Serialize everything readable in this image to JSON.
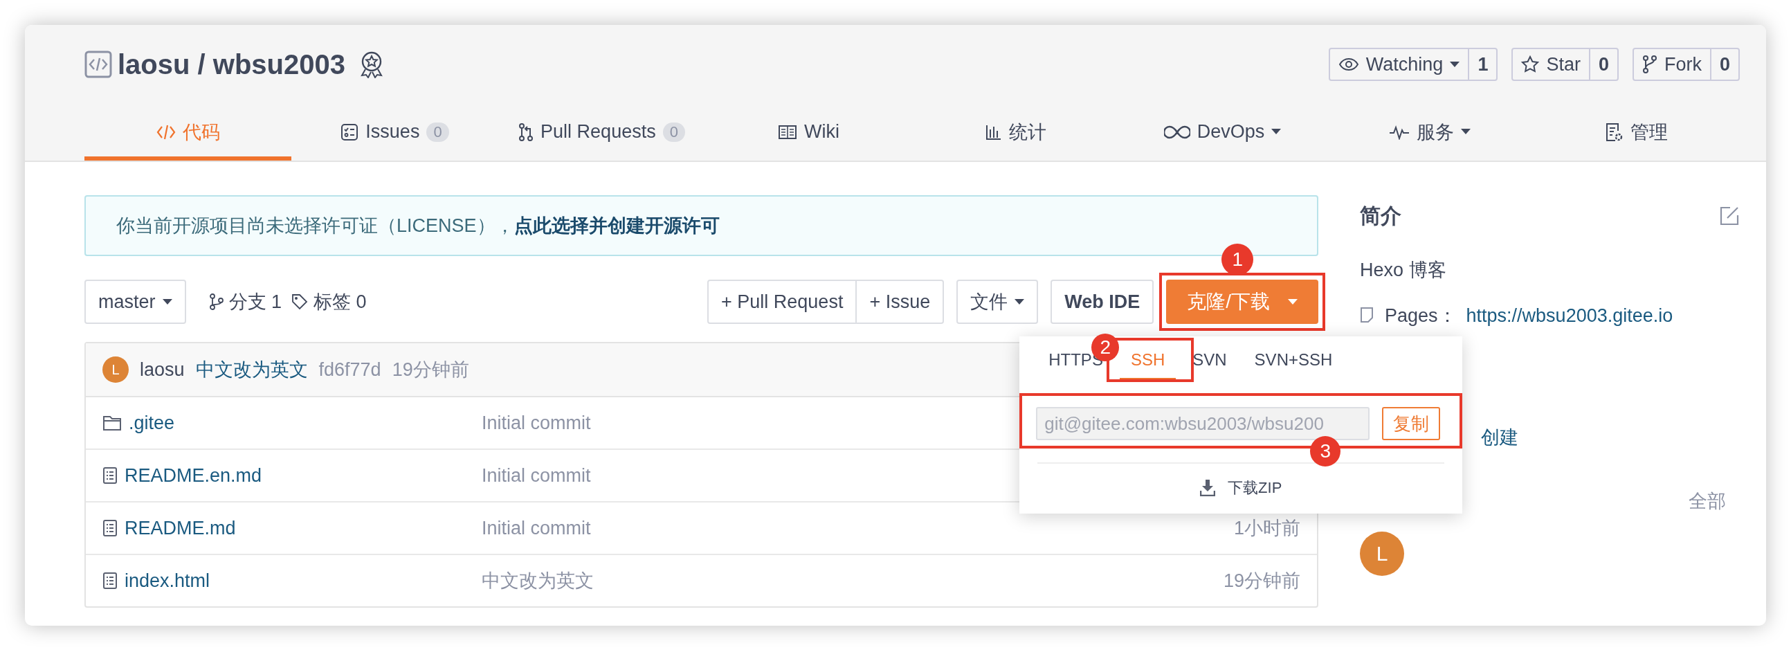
{
  "repo": {
    "title": "laosu / wbsu2003"
  },
  "actions": [
    {
      "label": "Watching",
      "count": "1",
      "dropdown": true
    },
    {
      "label": "Star",
      "count": "0",
      "dropdown": false
    },
    {
      "label": "Fork",
      "count": "0",
      "dropdown": false
    }
  ],
  "tabs": [
    {
      "kind": "code",
      "label": "代码",
      "selected": true
    },
    {
      "kind": "issues",
      "label": "Issues",
      "count": "0",
      "selected": false
    },
    {
      "kind": "pr",
      "label": "Pull Requests",
      "count": "0",
      "selected": false
    },
    {
      "kind": "wiki",
      "label": "Wiki",
      "selected": false
    },
    {
      "kind": "stats",
      "label": "统计",
      "selected": false
    },
    {
      "kind": "devops",
      "label": "DevOps",
      "dropdown": true,
      "selected": false
    },
    {
      "kind": "service",
      "label": "服务",
      "dropdown": true,
      "selected": false
    },
    {
      "kind": "manage",
      "label": "管理",
      "selected": false
    }
  ],
  "notice": {
    "text": "你当前开源项目尚未选择许可证（LICENSE），",
    "link": "点此选择并创建开源许可"
  },
  "toolbar": {
    "branch": "master",
    "branches": "分支 1",
    "tags": "标签 0",
    "buttons": [
      "+ Pull Request",
      "+ Issue"
    ],
    "file_menu": "文件",
    "web_ide": "Web IDE",
    "clone": "克隆/下载"
  },
  "commit": {
    "avatar": "L",
    "author": "laosu",
    "message": "中文改为英文",
    "hash": "fd6f77d",
    "time": "19分钟前"
  },
  "files": [
    {
      "kind": "folder",
      "name": ".gitee",
      "commit": "Initial commit"
    },
    {
      "kind": "file",
      "name": "README.en.md",
      "commit": "Initial commit"
    },
    {
      "kind": "file",
      "name": "README.md",
      "commit": "Initial commit",
      "time": "1小时前"
    },
    {
      "kind": "file",
      "name": "index.html",
      "commit": "中文改为英文",
      "time": "19分钟前"
    }
  ],
  "clone_menu": {
    "protocols": [
      {
        "label": "HTTPS",
        "selected": false
      },
      {
        "label": "SSH",
        "selected": true
      },
      {
        "label": "SVN",
        "selected": false
      },
      {
        "label": "SVN+SSH",
        "selected": false
      }
    ],
    "url": "git@gitee.com:wbsu2003/wbsu200",
    "copy": "复制",
    "download": "下载ZIP"
  },
  "sidebar": {
    "title": "简介",
    "description": "Hexo 博客",
    "pages_label": "Pages：",
    "pages_url": "https://wbsu2003.gitee.io",
    "created": "创建",
    "all": "全部",
    "contributors": [
      {
        "initial": "L"
      }
    ]
  },
  "annotations": [
    {
      "number": "1"
    },
    {
      "number": "2"
    },
    {
      "number": "3"
    }
  ]
}
